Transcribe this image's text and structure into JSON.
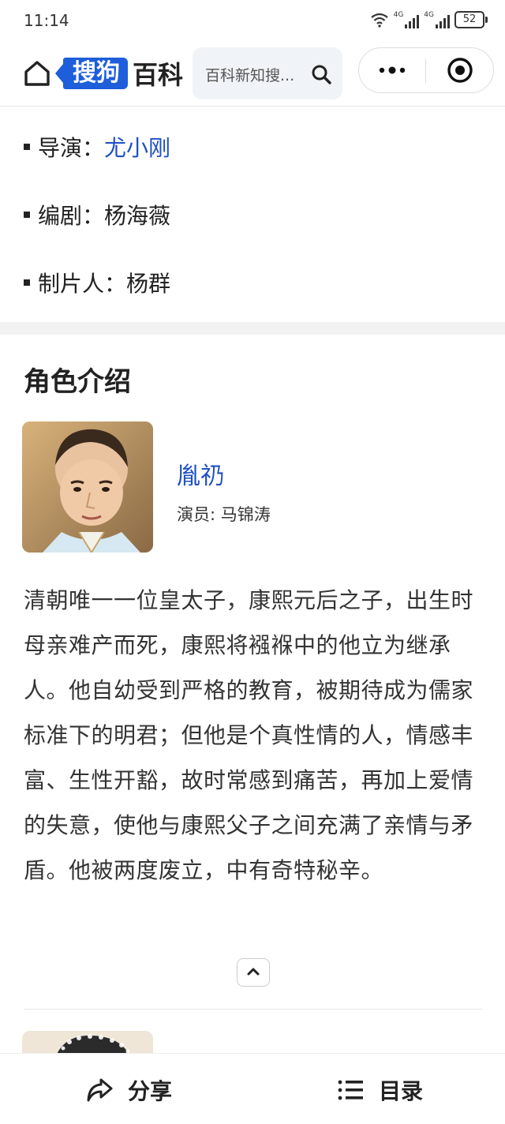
{
  "status_bar": {
    "time": "11:14",
    "signal_label_1": "4G",
    "signal_label_2": "4G",
    "battery": "52"
  },
  "header": {
    "logo_box": "搜狗",
    "logo_text": "百科",
    "search_placeholder": "百科新知搜..."
  },
  "info": [
    {
      "label": "导演：",
      "value": "尤小刚",
      "is_link": true
    },
    {
      "label": "编剧：",
      "value": "杨海薇",
      "is_link": false
    },
    {
      "label": "制片人：",
      "value": "杨群",
      "is_link": false
    }
  ],
  "roles": {
    "title": "角色介绍",
    "items": [
      {
        "name": "胤礽",
        "actor": "演员: 马锦涛",
        "description": "清朝唯一一位皇太子，康熙元后之子，出生时母亲难产而死，康熙将襁褓中的他立为继承人。他自幼受到严格的教育，被期待成为儒家标准下的明君；但他是个真性情的人，情感丰富、生性开豁，故时常感到痛苦，再加上爱情的失意，使他与康熙父子之间充满了亲情与矛盾。他被两度废立，中有奇特秘辛。"
      }
    ]
  },
  "bottom_bar": {
    "share": "分享",
    "toc": "目录"
  },
  "colors": {
    "brand": "#1e5edb",
    "link": "#1e4fc2"
  }
}
